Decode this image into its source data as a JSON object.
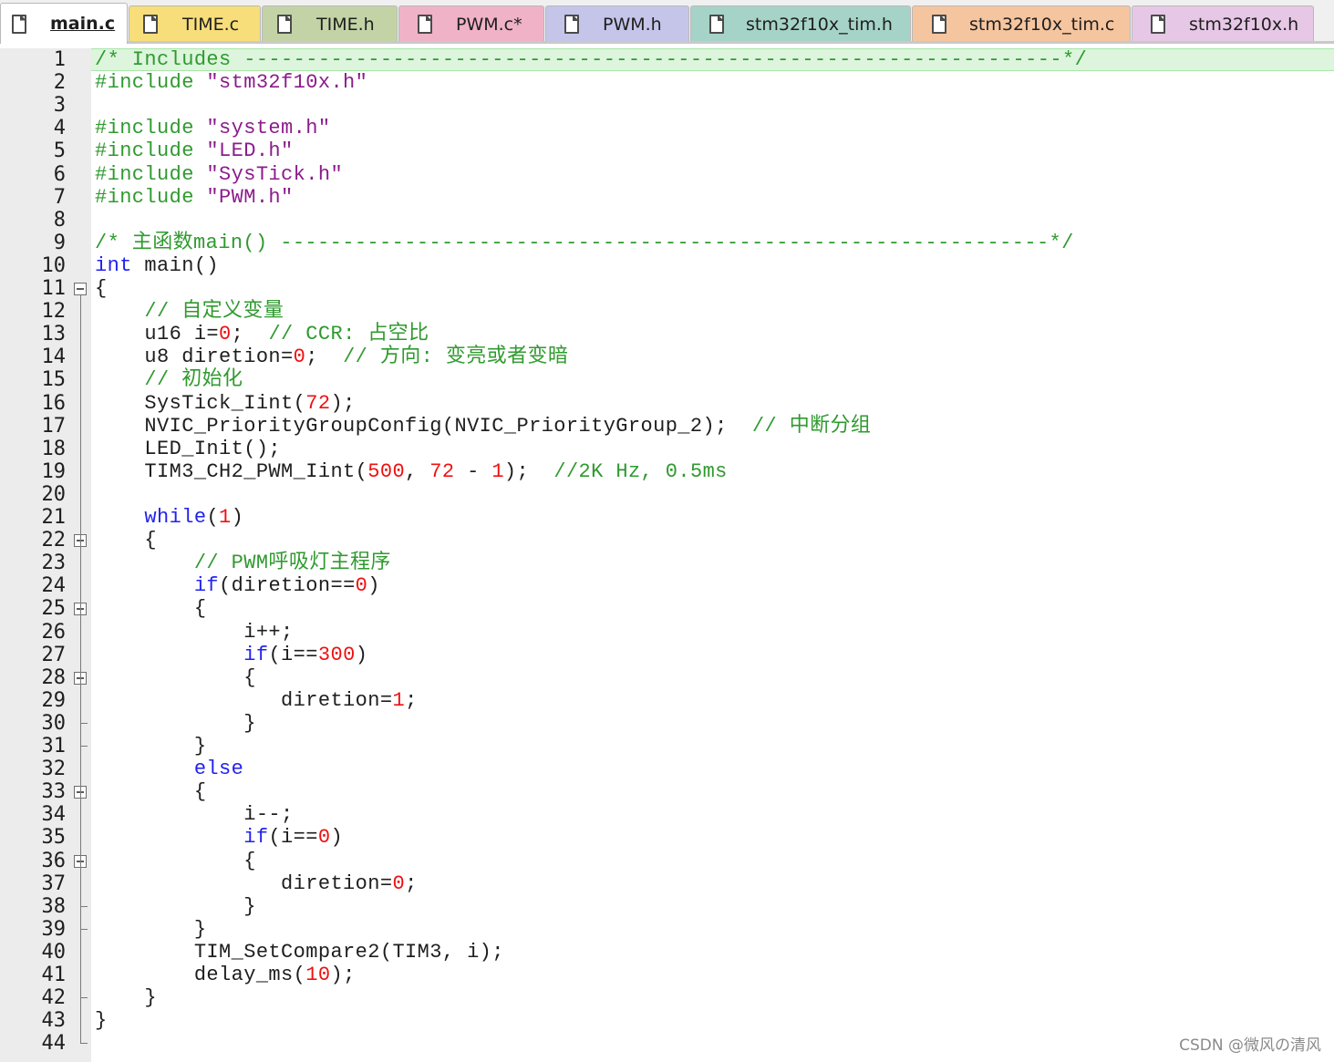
{
  "tabs": [
    {
      "label": "main.c",
      "color": "#ffffff",
      "active": true
    },
    {
      "label": "TIME.c",
      "color": "#f7de7a",
      "active": false
    },
    {
      "label": "TIME.h",
      "color": "#c3d3a6",
      "active": false
    },
    {
      "label": "PWM.c*",
      "color": "#efb2c6",
      "active": false
    },
    {
      "label": "PWM.h",
      "color": "#c5c5ea",
      "active": false
    },
    {
      "label": "stm32f10x_tim.h",
      "color": "#a6d3c7",
      "active": false
    },
    {
      "label": "stm32f10x_tim.c",
      "color": "#f5c59f",
      "active": false
    },
    {
      "label": "stm32f10x.h",
      "color": "#e6c7e6",
      "active": false
    }
  ],
  "colors": {
    "comment": "#2f9a2f",
    "keyword": "#2222ee",
    "number": "#ee1111",
    "string": "#8b1c8b",
    "current_line": "#dcf5dc"
  },
  "lines": [
    "/* Includes ------------------------------------------------------------------*/",
    "#include \"stm32f10x.h\"",
    "",
    "#include \"system.h\"",
    "#include \"LED.h\"",
    "#include \"SysTick.h\"",
    "#include \"PWM.h\"",
    "",
    "/* 主函数main() --------------------------------------------------------------*/",
    "int main()",
    "{",
    "    // 自定义变量",
    "    u16 i=0;  // CCR: 占空比",
    "    u8 diretion=0;  // 方向: 变亮或者变暗",
    "    // 初始化",
    "    SysTick_Iint(72);",
    "    NVIC_PriorityGroupConfig(NVIC_PriorityGroup_2);  // 中断分组",
    "    LED_Init();",
    "    TIM3_CH2_PWM_Iint(500, 72 - 1);  //2K Hz, 0.5ms",
    "",
    "    while(1)",
    "    {",
    "        // PWM呼吸灯主程序",
    "        if(diretion==0)",
    "        {",
    "            i++;",
    "            if(i==300)",
    "            {",
    "               diretion=1;",
    "            }",
    "        }",
    "        else",
    "        {",
    "            i--;",
    "            if(i==0)",
    "            {",
    "               diretion=0;",
    "            }",
    "        }",
    "        TIM_SetCompare2(TIM3, i);",
    "        delay_ms(10);",
    "    }",
    "}",
    ""
  ],
  "fold_markers": [
    11,
    22,
    25,
    28,
    33,
    36
  ],
  "watermark": "CSDN @微风の清风"
}
